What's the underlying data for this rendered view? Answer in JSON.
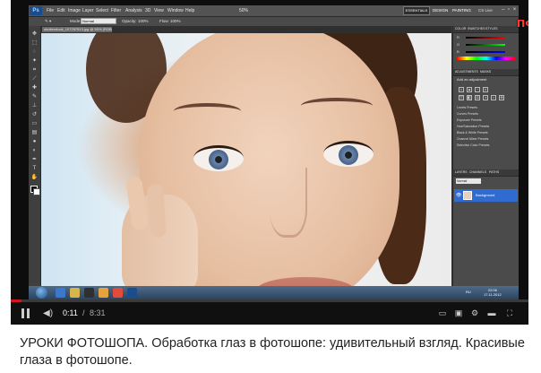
{
  "photoshop": {
    "logo": "Ps",
    "menu": [
      "File",
      "Edit",
      "Image",
      "Layer",
      "Select",
      "Filter",
      "Analysis",
      "3D",
      "View",
      "Window",
      "Help"
    ],
    "zoom": "50%",
    "workspaces": [
      "ESSENTIALS",
      "DESIGN",
      "PAINTING"
    ],
    "cs_live": "CS Live",
    "options": {
      "mode_label": "Mode:",
      "mode_value": "Normal",
      "opacity_label": "Opacity:",
      "opacity_value": "100%",
      "flow_label": "Flow:",
      "flow_value": "100%"
    },
    "document_tab": "shutterstock_107297513.jpg @ 50% (RGB/8#)",
    "panels": {
      "color_tab": "COLOR",
      "swatches_tab": "SWATCHES",
      "styles_tab": "STYLES",
      "slider_labels": [
        "R",
        "G",
        "B"
      ],
      "adjustments_tab": "ADJUSTMENTS",
      "masks_tab": "MASKS",
      "add_adjustment": "Add an adjustment",
      "presets": [
        "Levels Presets",
        "Curves Presets",
        "Exposure Presets",
        "Hue/Saturation Presets",
        "Black & White Presets",
        "Channel Mixer Presets",
        "Selective Color Presets"
      ],
      "layers_tab": "LAYERS",
      "channels_tab": "CHANNELS",
      "paths_tab": "PATHS",
      "blend_mode": "Normal",
      "layer_name": "Background"
    }
  },
  "taskbar": {
    "language": "RU",
    "time": "22:06",
    "date": "17.11.2012"
  },
  "channel_watermark": "ПФ",
  "player": {
    "current_time": "0:11",
    "separator": "/",
    "total_time": "8:31",
    "progress": 0.0215,
    "accent": "#cc181e"
  },
  "video_title": "УРОКИ ФОТОШОПА. Обработка глаз в фотошопе: удивительный взгляд. Красивые глаза в фотошопе."
}
